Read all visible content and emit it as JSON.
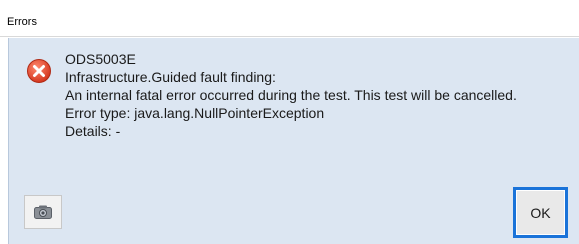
{
  "window": {
    "title": "Errors"
  },
  "error": {
    "code": "ODS5003E",
    "source": "Infrastructure.Guided fault finding:",
    "message": "An internal fatal error occurred during the test. This test will be cancelled.",
    "error_type": "Error type: java.lang.NullPointerException",
    "details": "Details: -"
  },
  "buttons": {
    "ok_label": "OK"
  },
  "icons": {
    "error": "error-x-icon",
    "camera": "camera-icon"
  },
  "colors": {
    "dialog_background": "#dce6f2",
    "error_red": "#e0452b",
    "focus_blue": "#1a73d9"
  }
}
